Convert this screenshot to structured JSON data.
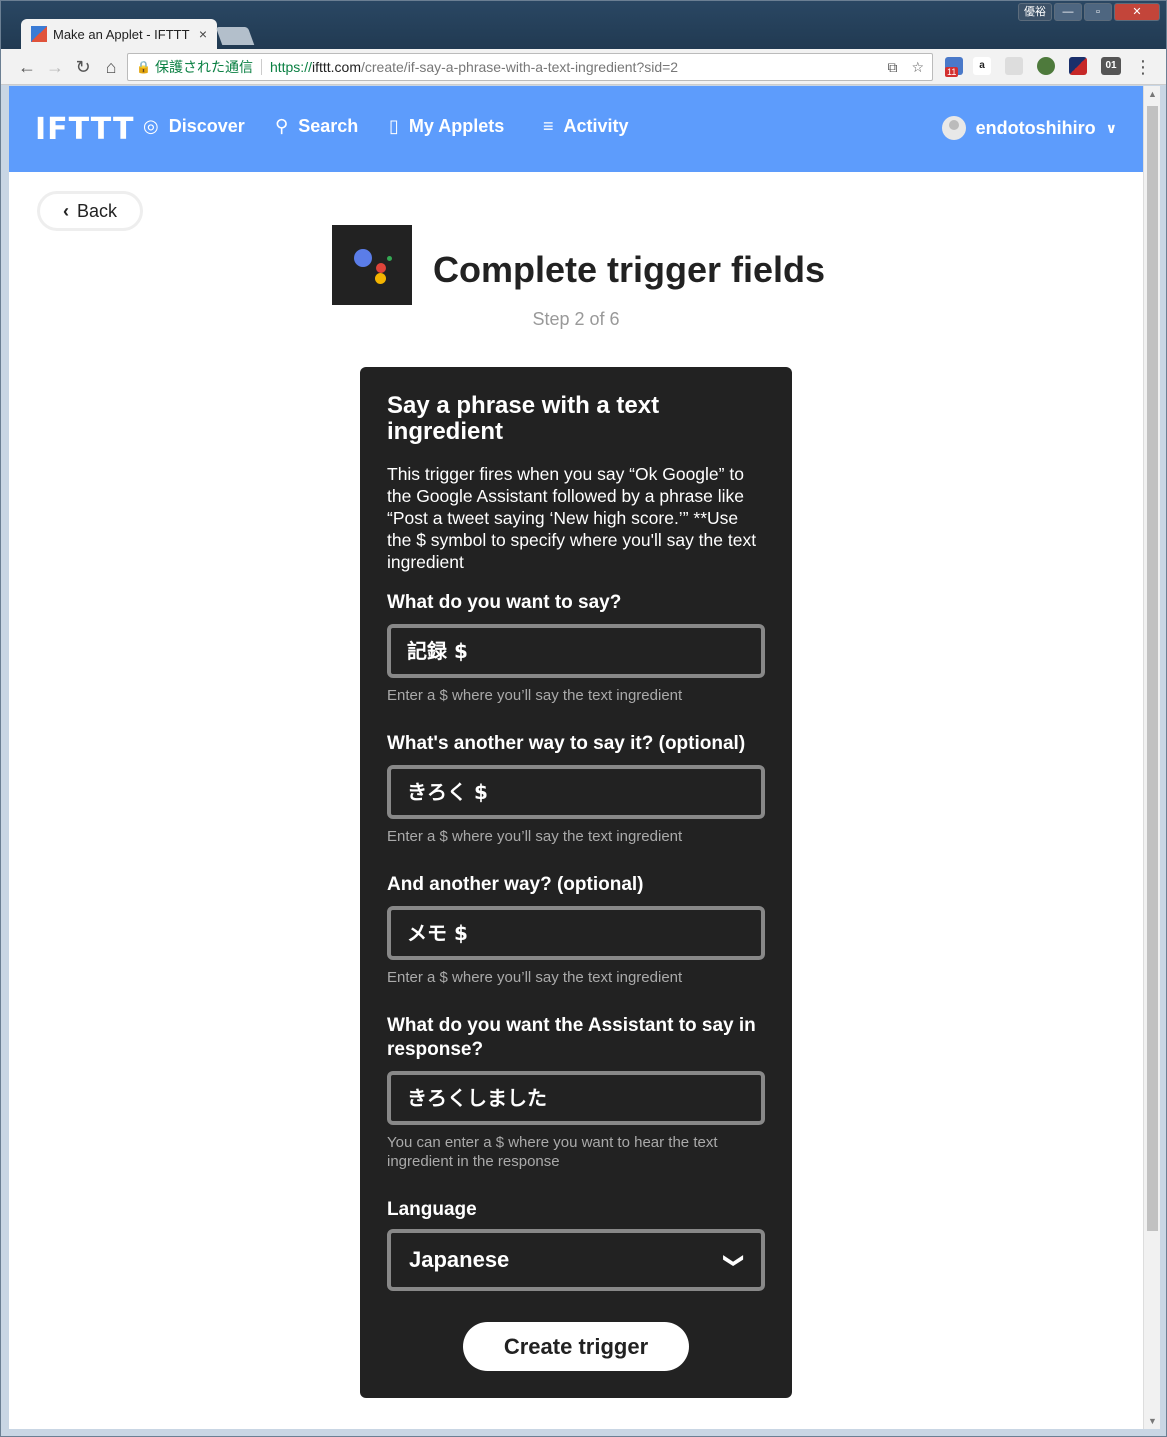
{
  "browser": {
    "tab_title": "Make an Applet - IFTTT",
    "tab_close": "×",
    "window_user": "優裕",
    "secure_label": "保護された通信",
    "url_scheme": "https://",
    "url_host": "ifttt.com",
    "url_path": "/create/if-say-a-phrase-with-a-text-ingredient?sid=2",
    "ext_badge": "11",
    "ext_counter": "01"
  },
  "header": {
    "logo": "IFTTT",
    "nav": {
      "discover": "Discover",
      "search": "Search",
      "my_applets": "My Applets",
      "activity": "Activity"
    },
    "username": "endotoshihiro",
    "brand_color": "#5d9cfc"
  },
  "back_label": "Back",
  "title": "Complete trigger fields",
  "step": "Step 2 of 6",
  "card": {
    "trigger_name": "Say a phrase with a text ingredient",
    "description": "This trigger fires when you say “Ok Google” to the Google Assistant followed by a phrase like “Post a tweet saying ‘New high score.’” **Use the $ symbol to specify where you'll say the text ingredient",
    "fields": [
      {
        "label": "What do you want to say?",
        "value": "記録 $",
        "help": "Enter a $ where you’ll say the text ingredient"
      },
      {
        "label": "What's another way to say it? (optional)",
        "value": "きろく $",
        "help": "Enter a $ where you’ll say the text ingredient"
      },
      {
        "label": "And another way? (optional)",
        "value": "メモ $",
        "help": "Enter a $ where you’ll say the text ingredient"
      },
      {
        "label": "What do you want the Assistant to say in response?",
        "value": "きろくしました",
        "help": "You can enter a $ where you want to hear the text ingredient in the response"
      }
    ],
    "language_label": "Language",
    "language_value": "Japanese",
    "submit_label": "Create trigger"
  }
}
